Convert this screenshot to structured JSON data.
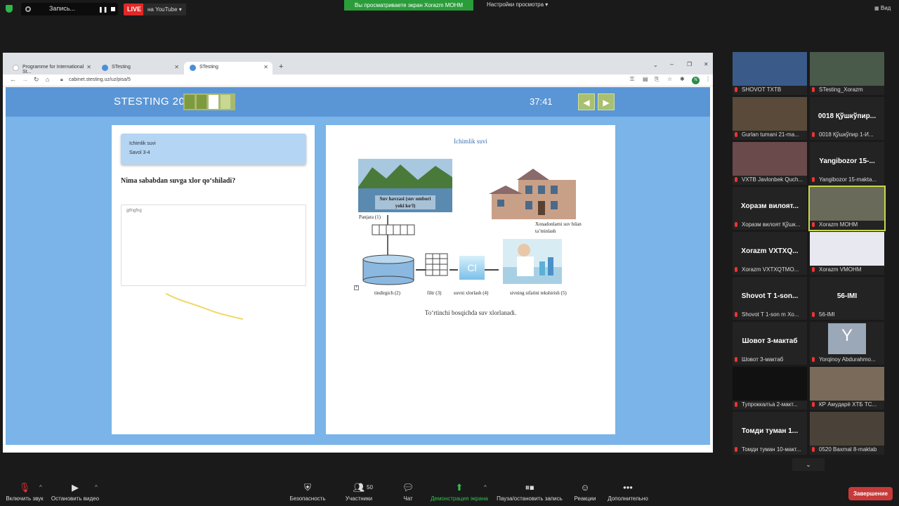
{
  "topbar": {
    "recording_label": "Запись...",
    "live_label": "LIVE",
    "youtube_label": "на YouTube",
    "share_banner": "Вы просматриваете экран Xorazm MOHM",
    "view_options": "Настройки просмотра",
    "view_button": "Вид"
  },
  "browser": {
    "tabs": [
      {
        "title": "Programme for International St..."
      },
      {
        "title": "STesting"
      },
      {
        "title": "STesting"
      }
    ],
    "url": "cabinet.stesting.uz/uz/pisa/5",
    "profile_initial": "N"
  },
  "site": {
    "logo": "STESTING 2021",
    "timer": "37:41",
    "question_card": {
      "title": "Ichimlik suvi",
      "number": "Savol 3-4"
    },
    "question": "Nima sababdan suvga xlor qo‘shiladi?",
    "answer_value": "gtfngfng",
    "info": {
      "title": "Ichimlik suvi",
      "reservoir_label": "Suv havzasi (suv ombori yoki ko‘l)",
      "grate_label": "Panjara (1)",
      "tank_label": "tindirgich (2)",
      "filter_label": "filtr (3)",
      "chlor_label": "suvni xlorlash (4)",
      "quality_label": "sivning sifatini tekshirish (5)",
      "house_label": "Xonadonlarni suv bilan ta’minlash",
      "cl_symbol": "Cl",
      "caption": "To‘rtinchi bosqichda suv xlorlanadi."
    },
    "brand_color": "#5a96d6"
  },
  "participants": [
    {
      "name": "SHOVOT TXTB",
      "big": ""
    },
    {
      "name": "STesting_Xorazm",
      "big": ""
    },
    {
      "name": "Gurlan tumani 21-ma...",
      "big": ""
    },
    {
      "name": "0018 Қўшкўпир 1-И...",
      "big": "0018 Қўшкўпир..."
    },
    {
      "name": "VXTB Javlonbek Quch...",
      "big": ""
    },
    {
      "name": "Yangibozor 15-makta...",
      "big": "Yangibozor 15-..."
    },
    {
      "name": "Хоразм вилоят Қўшк...",
      "big": "Хоразм вилоят..."
    },
    {
      "name": "Xorazm MOHM",
      "big": ""
    },
    {
      "name": "Xorazm VXTXQTMO...",
      "big": "Xorazm VXTXQ..."
    },
    {
      "name": "Xorazm VMOHM",
      "big": ""
    },
    {
      "name": "Shovot T 1-son m Xo...",
      "big": "Shovot T 1-son..."
    },
    {
      "name": "56-IMI",
      "big": "56-IMI"
    },
    {
      "name": "Шовот 3-мактаб",
      "big": "Шовот 3-мактаб"
    },
    {
      "name": "Yorqinoy Abdurahmo...",
      "big": "Y"
    },
    {
      "name": "Тупроккалъа 2-макт...",
      "big": ""
    },
    {
      "name": "КР Амударё ХТБ ТС...",
      "big": ""
    },
    {
      "name": "Томди туман 10-макт...",
      "big": "Томди туман 1..."
    },
    {
      "name": "0520 Baxmal 8-maktab",
      "big": ""
    }
  ],
  "toolbar": {
    "unmute": "Включить звук",
    "video": "Остановить видео",
    "security": "Безопасность",
    "participants": "Участники",
    "participants_count": "50",
    "chat": "Чат",
    "share": "Демонстрация экрана",
    "pause": "Пауза/остановить запись",
    "reactions": "Реакции",
    "more": "Дополнительно",
    "end": "Завершение"
  }
}
